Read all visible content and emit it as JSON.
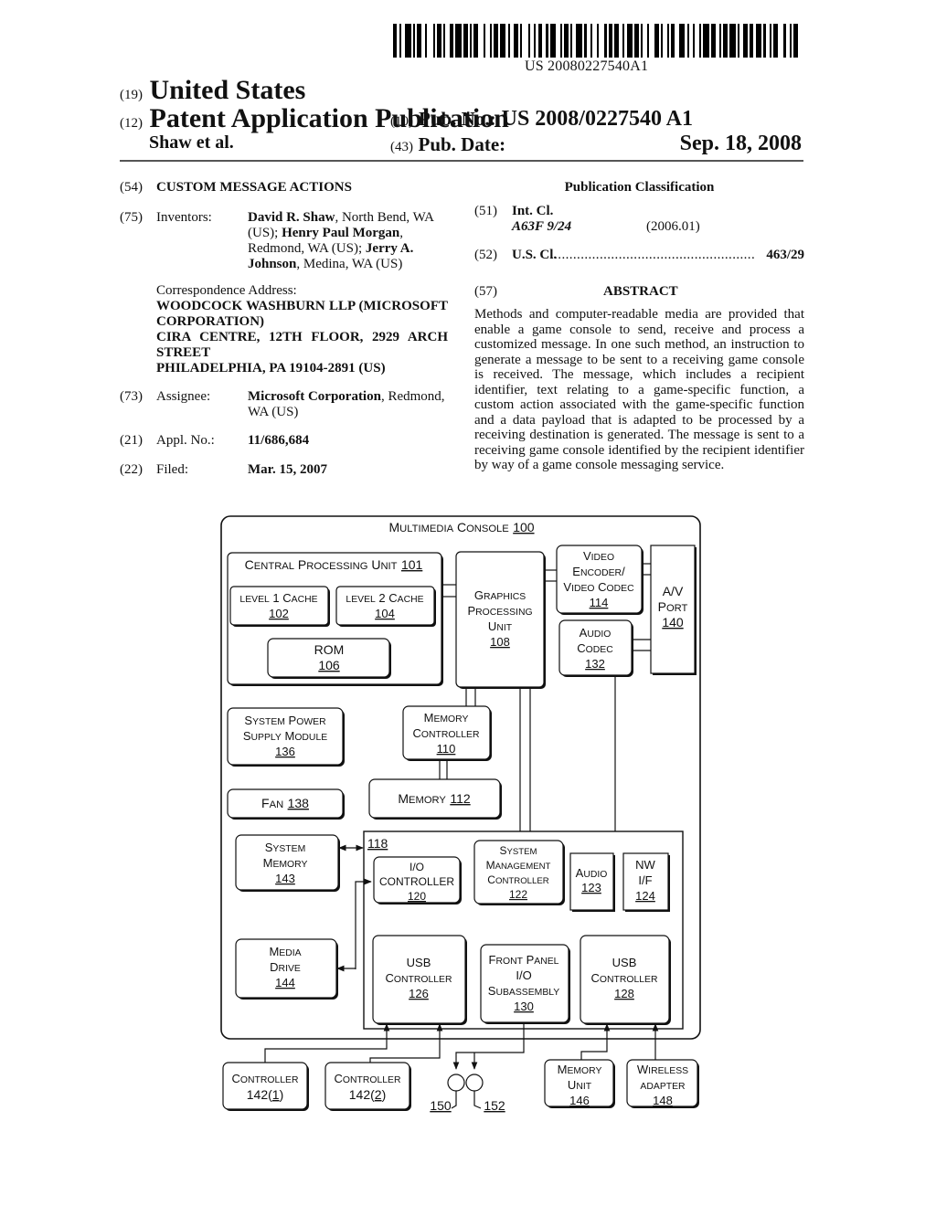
{
  "header": {
    "barcode_number": "US 20080227540A1",
    "country_code": "(19)",
    "country": "United States",
    "kind_code": "(12)",
    "publication_type": "Patent Application Publication",
    "authors": "Shaw et al.",
    "pub_no_code": "(10)",
    "pub_no_label": "Pub. No.:",
    "pub_no": "US 2008/0227540 A1",
    "pub_date_code": "(43)",
    "pub_date_label": "Pub. Date:",
    "pub_date": "Sep. 18, 2008"
  },
  "left_column": {
    "title": {
      "code": "(54)",
      "text": "CUSTOM MESSAGE ACTIONS"
    },
    "inventors": {
      "code": "(75)",
      "label": "Inventors:",
      "lines": [
        [
          {
            "t": "David R. Shaw",
            "b": true
          },
          {
            "t": ", North Bend, WA",
            "b": false
          }
        ],
        [
          {
            "t": "(US); ",
            "b": false
          },
          {
            "t": "Henry Paul Morgan",
            "b": true
          },
          {
            "t": ",",
            "b": false
          }
        ],
        [
          {
            "t": "Redmond, WA (US); ",
            "b": false
          },
          {
            "t": "Jerry A.",
            "b": true
          }
        ],
        [
          {
            "t": "Johnson",
            "b": true
          },
          {
            "t": ", Medina, WA (US)",
            "b": false
          }
        ]
      ]
    },
    "correspondence": {
      "label": "Correspondence Address:",
      "lines": [
        "WOODCOCK WASHBURN LLP (MICROSOFT",
        "CORPORATION)",
        "CIRA CENTRE, 12TH FLOOR, 2929 ARCH",
        "STREET",
        "PHILADELPHIA, PA 19104-2891 (US)"
      ]
    },
    "assignee": {
      "code": "(73)",
      "label": "Assignee:",
      "name": "Microsoft Corporation",
      "location_line1": ", Redmond,",
      "location_line2": "WA (US)"
    },
    "appl_no": {
      "code": "(21)",
      "label": "Appl. No.:",
      "value": "11/686,684"
    },
    "filed": {
      "code": "(22)",
      "label": "Filed:",
      "value": "Mar. 15, 2007"
    }
  },
  "right_column": {
    "classification_heading": "Publication Classification",
    "int_cl": {
      "code": "(51)",
      "label": "Int. Cl.",
      "class": "A63F 9/24",
      "version": "(2006.01)"
    },
    "us_cl": {
      "code": "(52)",
      "label": "U.S. Cl.",
      "dots": "........................................................",
      "value": "463/29"
    },
    "abstract": {
      "code": "(57)",
      "heading": "ABSTRACT",
      "text": "Methods and computer-readable media are provided that enable a game console to send, receive and process a customized message. In one such method, an instruction to generate a message to be sent to a receiving game console is received. The message, which includes a recipient identifier, text relating to a game-specific function, a custom action associated with the game-specific function and a data payload that is adapted to be processed by a receiving destination is generated. The message is sent to a receiving game console identified by the recipient identifier by way of a game console messaging service."
    }
  },
  "diagram": {
    "console": {
      "label": "Multimedia Console",
      "ref": "100"
    },
    "cpu": {
      "label": "Central Processing Unit",
      "ref": "101"
    },
    "l1": {
      "label": "level 1 Cache",
      "ref": "102"
    },
    "l2": {
      "label": "level 2 Cache",
      "ref": "104"
    },
    "rom": {
      "label": "ROM",
      "ref": "106"
    },
    "gpu": {
      "lines": [
        "Graphics",
        "Processing",
        "Unit"
      ],
      "ref": "108"
    },
    "video": {
      "lines": [
        "Video",
        "Encoder/",
        "Video Codec"
      ],
      "ref": "114"
    },
    "audio_codec": {
      "lines": [
        "Audio",
        "Codec"
      ],
      "ref": "132"
    },
    "av_port": {
      "lines": [
        "A/V",
        "Port"
      ],
      "ref": "140"
    },
    "psu": {
      "lines": [
        "System Power",
        "Supply Module"
      ],
      "ref": "136"
    },
    "mem_ctrl": {
      "lines": [
        "Memory",
        "Controller"
      ],
      "ref": "110"
    },
    "fan": {
      "label": "Fan",
      "ref": "138"
    },
    "memory": {
      "label": "Memory",
      "ref": "112"
    },
    "sys_mem": {
      "lines": [
        "System",
        "Memory"
      ],
      "ref": "143"
    },
    "bus_ref": "118",
    "io_ctrl": {
      "lines": [
        "I/O",
        "CONTROLLER"
      ],
      "ref": "120"
    },
    "smc": {
      "lines": [
        "System",
        "Management",
        "Controller"
      ],
      "ref": "122"
    },
    "audio": {
      "lines": [
        "Audio"
      ],
      "ref": "123"
    },
    "nw": {
      "lines": [
        "NW",
        "I/F"
      ],
      "ref": "124"
    },
    "media_drive": {
      "lines": [
        "Media",
        "Drive"
      ],
      "ref": "144"
    },
    "usb126": {
      "lines": [
        "USB",
        "Controller"
      ],
      "ref": "126"
    },
    "front_panel": {
      "lines": [
        "Front Panel",
        "I/O",
        "Subassembly"
      ],
      "ref": "130"
    },
    "usb128": {
      "lines": [
        "USB",
        "Controller"
      ],
      "ref": "128"
    },
    "ctrl1": {
      "label": "Controller",
      "ref_prefix": "142(",
      "ref_num": "1",
      "ref_suffix": ")"
    },
    "ctrl2": {
      "label": "Controller",
      "ref_prefix": "142(",
      "ref_num": "2",
      "ref_suffix": ")"
    },
    "led150": "150",
    "led152": "152",
    "mem_unit": {
      "lines": [
        "Memory",
        "Unit"
      ],
      "ref": "146"
    },
    "wireless": {
      "lines": [
        "Wireless",
        "adapter"
      ],
      "ref": "148"
    }
  }
}
